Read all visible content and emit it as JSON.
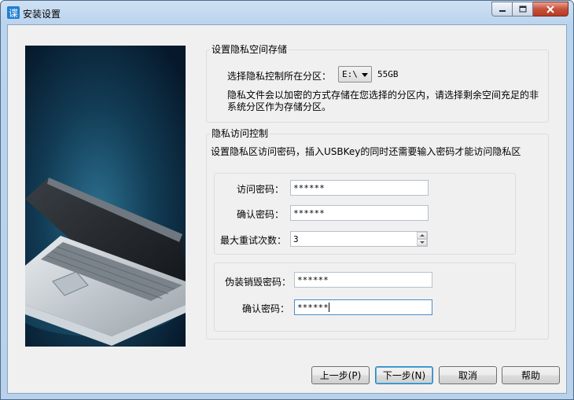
{
  "window": {
    "title": "安装设置",
    "app_icon": "app-logo-icon"
  },
  "colors": {
    "title_bar": "#bad3ee",
    "close_button": "#c7503b",
    "client_bg": "#f0f0f0",
    "hero_bg": "#0c2a3e"
  },
  "privacy_space": {
    "group_label": "设置隐私空间存储",
    "partition_label": "选择隐私控制所在分区：",
    "partition_value": "E:\\",
    "partition_size": "55GB",
    "description": "隐私文件会以加密的方式存储在您选择的分区内，请选择剩余空间充足的非系统分区作为存储分区。"
  },
  "access_control": {
    "group_label": "隐私访问控制",
    "description": "设置隐私区访问密码，插入USBKey的同时还需要输入密码才能访问隐私区",
    "access_password_label": "访问密码：",
    "access_password_value": "******",
    "confirm_password_label": "确认密码：",
    "confirm_password_value": "******",
    "max_retries_label": "最大重试次数：",
    "max_retries_value": "3",
    "decoy_password_label": "伪装销毁密码：",
    "decoy_password_value": "******",
    "decoy_confirm_label": "确认密码：",
    "decoy_confirm_value": "******"
  },
  "buttons": {
    "back": "上一步(P)",
    "next": "下一步(N)",
    "cancel": "取消",
    "help": "帮助"
  }
}
